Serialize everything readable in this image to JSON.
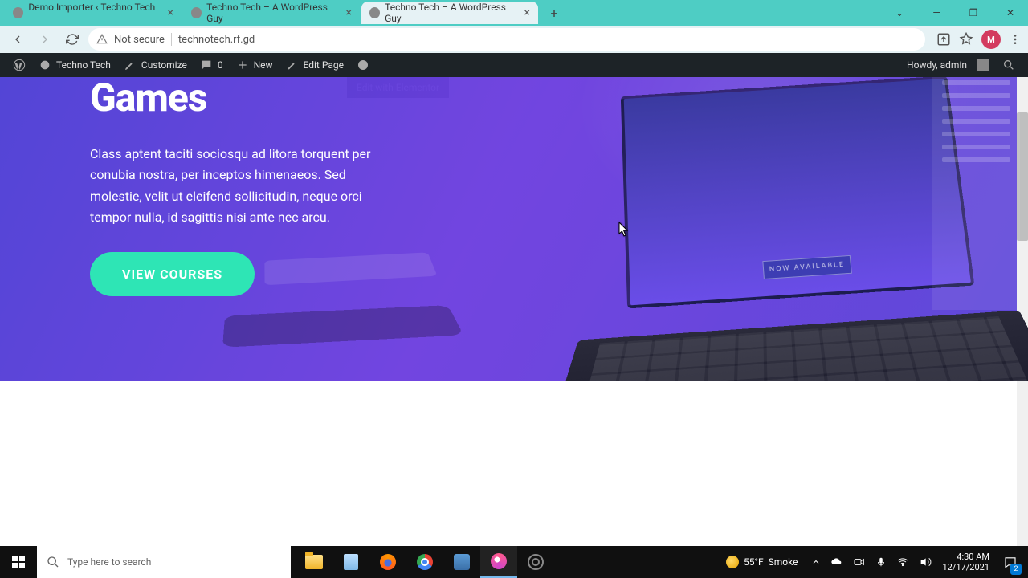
{
  "browser": {
    "tabs": [
      {
        "title": "Demo Importer ‹ Techno Tech —",
        "active": false
      },
      {
        "title": "Techno Tech – A WordPress Guy",
        "active": false
      },
      {
        "title": "Techno Tech – A WordPress Guy",
        "active": true
      }
    ],
    "address": {
      "security": "Not secure",
      "url": "technotech.rf.gd"
    },
    "profile_letter": "M"
  },
  "wp_bar": {
    "site_name": "Techno Tech",
    "customize": "Customize",
    "comments": "0",
    "new": "New",
    "edit_page": "Edit Page",
    "howdy": "Howdy, admin",
    "submenu": "Edit with Elementor"
  },
  "hero": {
    "title": "Games",
    "description": "Class aptent taciti sociosqu ad litora torquent per conubia nostra, per inceptos himenaeos. Sed molestie, velit ut eleifend sollicitudin, neque orci tempor nulla, id sagittis nisi ante nec arcu.",
    "button": "VIEW COURSES",
    "laptop_badge": "NOW AVAILABLE"
  },
  "taskbar": {
    "search_placeholder": "Type here to search",
    "weather_temp": "55°F",
    "weather_cond": "Smoke",
    "time": "4:30 AM",
    "date": "12/17/2021",
    "notif_count": "2"
  }
}
